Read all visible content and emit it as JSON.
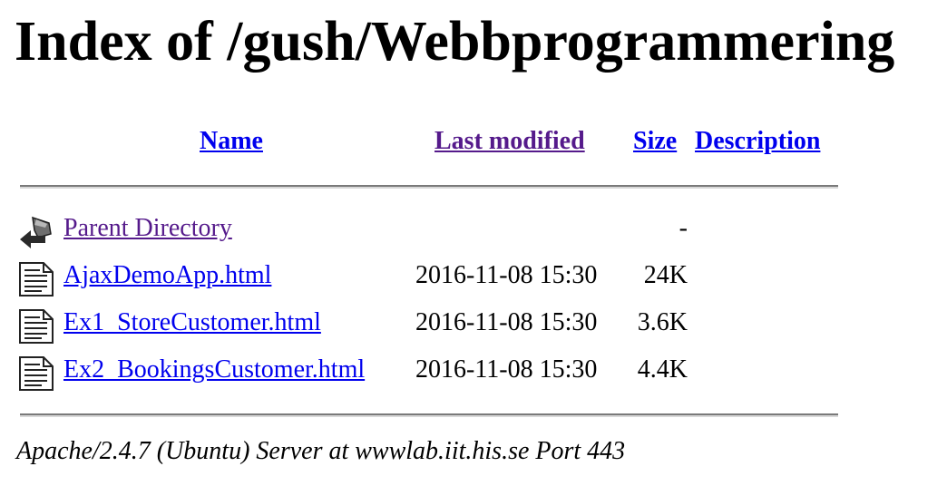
{
  "title": "Index of /gush/Webbprogrammering",
  "columns": {
    "name": "Name",
    "last_modified": "Last modified",
    "size": "Size",
    "description": "Description"
  },
  "rows": [
    {
      "icon": "back-arrow-icon",
      "name": "Parent Directory",
      "modified": "",
      "size": "-"
    },
    {
      "icon": "text-document-icon",
      "name": "AjaxDemoApp.html",
      "modified": "2016-11-08 15:30",
      "size": "24K"
    },
    {
      "icon": "text-document-icon",
      "name": "Ex1_StoreCustomer.html",
      "modified": "2016-11-08 15:30",
      "size": "3.6K"
    },
    {
      "icon": "text-document-icon",
      "name": "Ex2_BookingsCustomer.html",
      "modified": "2016-11-08 15:30",
      "size": "4.4K"
    }
  ],
  "footer": "Apache/2.4.7 (Ubuntu) Server at wwwlab.iit.his.se Port 443",
  "colors": {
    "link": "#0000ee",
    "visited": "#551a8b",
    "rule": "#7a7a7a"
  }
}
